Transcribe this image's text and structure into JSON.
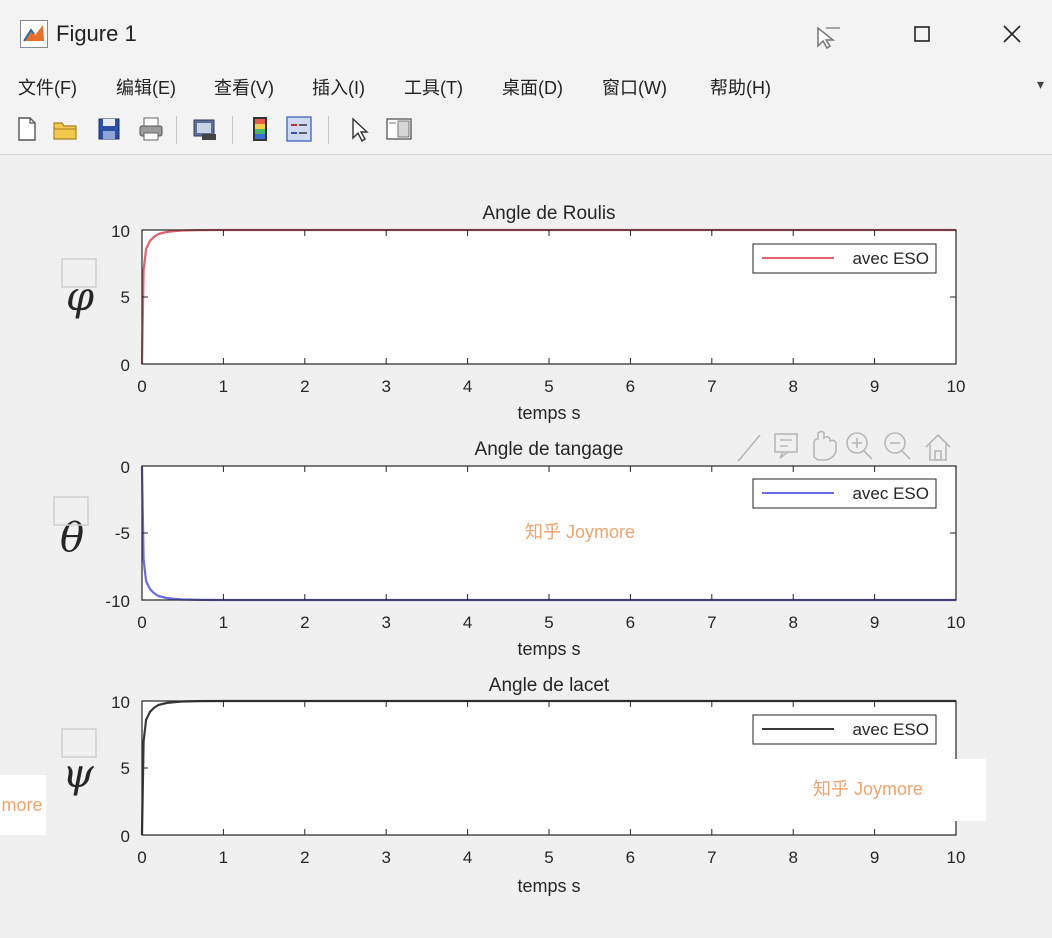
{
  "window": {
    "title": "Figure 1",
    "icon": "matlab-figure-icon",
    "buttons": [
      "cursor-icon",
      "maximize-icon",
      "close-icon"
    ]
  },
  "menu": [
    "文件(F)",
    "编辑(E)",
    "查看(V)",
    "插入(I)",
    "工具(T)",
    "桌面(D)",
    "窗口(W)",
    "帮助(H)"
  ],
  "toolbar": {
    "icons": [
      "new-figure-icon",
      "open-file-icon",
      "save-icon",
      "print-icon",
      "link-plot-icon",
      "colorbar-icon",
      "legend-icon",
      "select-arrow-icon",
      "property-editor-icon"
    ]
  },
  "axes_toolbar": {
    "icons": [
      "brush-icon",
      "data-tip-icon",
      "pan-icon",
      "zoom-in-icon",
      "zoom-out-icon",
      "home-icon"
    ]
  },
  "watermarks": [
    "知乎 Joymore",
    "知乎 Joymore",
    "more"
  ],
  "colors": {
    "roulis": "#e8606e",
    "tangage": "#6a6ae6",
    "lacet": "#3a3a3a",
    "axes_bg": "#ffffff",
    "watermark": "#f4a36c"
  },
  "chart_data": [
    {
      "type": "line",
      "title": "Angle de Roulis",
      "xlabel": "temps s",
      "ylabel": "φ",
      "xlim": [
        0,
        10
      ],
      "ylim": [
        0,
        10
      ],
      "xticks": [
        "0",
        "1",
        "2",
        "3",
        "4",
        "5",
        "6",
        "7",
        "8",
        "9",
        "10"
      ],
      "yticks": [
        "0",
        "5",
        "10"
      ],
      "grid": false,
      "legend": {
        "position": "top-right",
        "entries": [
          "avec ESO"
        ]
      },
      "series": [
        {
          "name": "avec ESO",
          "color": "#e8606e",
          "x": [
            0,
            0.02,
            0.05,
            0.1,
            0.15,
            0.2,
            0.3,
            0.4,
            0.5,
            0.7,
            1,
            2,
            4,
            6,
            8,
            10
          ],
          "y": [
            0,
            7.0,
            8.6,
            9.2,
            9.5,
            9.7,
            9.85,
            9.92,
            9.96,
            9.99,
            10,
            10,
            10,
            10,
            10,
            10
          ]
        }
      ]
    },
    {
      "type": "line",
      "title": "Angle de tangage",
      "xlabel": "temps s",
      "ylabel": "θ",
      "xlim": [
        0,
        10
      ],
      "ylim": [
        -10,
        0
      ],
      "xticks": [
        "0",
        "1",
        "2",
        "3",
        "4",
        "5",
        "6",
        "7",
        "8",
        "9",
        "10"
      ],
      "yticks": [
        "0",
        "-5",
        "-10"
      ],
      "grid": false,
      "legend": {
        "position": "top-right",
        "entries": [
          "avec ESO"
        ]
      },
      "series": [
        {
          "name": "avec ESO",
          "color": "#6a6ae6",
          "x": [
            0,
            0.02,
            0.05,
            0.1,
            0.15,
            0.2,
            0.3,
            0.4,
            0.5,
            0.7,
            1,
            2,
            4,
            6,
            8,
            10
          ],
          "y": [
            0,
            -7.0,
            -8.6,
            -9.2,
            -9.5,
            -9.7,
            -9.85,
            -9.92,
            -9.96,
            -9.99,
            -10,
            -10,
            -10,
            -10,
            -10,
            -10
          ]
        }
      ]
    },
    {
      "type": "line",
      "title": "Angle de lacet",
      "xlabel": "temps s",
      "ylabel": "ψ",
      "xlim": [
        0,
        10
      ],
      "ylim": [
        0,
        10
      ],
      "xticks": [
        "0",
        "1",
        "2",
        "3",
        "4",
        "5",
        "6",
        "7",
        "8",
        "9",
        "10"
      ],
      "yticks": [
        "0",
        "5",
        "10"
      ],
      "grid": false,
      "legend": {
        "position": "top-right",
        "entries": [
          "avec ESO"
        ]
      },
      "series": [
        {
          "name": "avec ESO",
          "color": "#3a3a3a",
          "x": [
            0,
            0.02,
            0.05,
            0.1,
            0.15,
            0.2,
            0.3,
            0.4,
            0.5,
            0.7,
            1,
            2,
            4,
            6,
            8,
            10
          ],
          "y": [
            0,
            7.0,
            8.6,
            9.2,
            9.5,
            9.7,
            9.85,
            9.92,
            9.96,
            9.99,
            10,
            10,
            10,
            10,
            10,
            10
          ]
        }
      ]
    }
  ]
}
